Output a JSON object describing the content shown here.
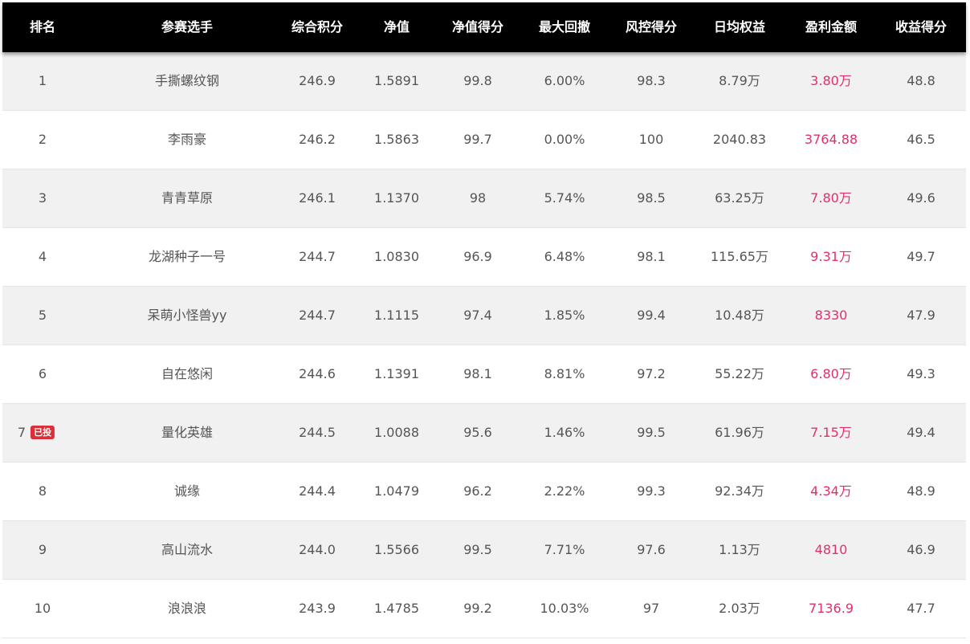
{
  "colors": {
    "header_bg": "#000000",
    "header_text": "#ffffff",
    "row_odd_bg": "#f1f1f1",
    "row_even_bg": "#ffffff",
    "text": "#555555",
    "profit_text": "#e0306a",
    "badge_bg": "#d9303a"
  },
  "table": {
    "headers": [
      "排名",
      "参赛选手",
      "综合积分",
      "净值",
      "净值得分",
      "最大回撤",
      "风控得分",
      "日均权益",
      "盈利金额",
      "收益得分"
    ],
    "rows": [
      {
        "rank": "1",
        "badge": "",
        "player": "手撕螺纹钢",
        "score": "246.9",
        "nav": "1.5891",
        "nav_score": "99.8",
        "max_drawdown": "6.00%",
        "risk_score": "98.3",
        "avg_equity": "8.79万",
        "profit": "3.80万",
        "return_score": "48.8"
      },
      {
        "rank": "2",
        "badge": "",
        "player": "李雨豪",
        "score": "246.2",
        "nav": "1.5863",
        "nav_score": "99.7",
        "max_drawdown": "0.00%",
        "risk_score": "100",
        "avg_equity": "2040.83",
        "profit": "3764.88",
        "return_score": "46.5"
      },
      {
        "rank": "3",
        "badge": "",
        "player": "青青草原",
        "score": "246.1",
        "nav": "1.1370",
        "nav_score": "98",
        "max_drawdown": "5.74%",
        "risk_score": "98.5",
        "avg_equity": "63.25万",
        "profit": "7.80万",
        "return_score": "49.6"
      },
      {
        "rank": "4",
        "badge": "",
        "player": "龙湖种子一号",
        "score": "244.7",
        "nav": "1.0830",
        "nav_score": "96.9",
        "max_drawdown": "6.48%",
        "risk_score": "98.1",
        "avg_equity": "115.65万",
        "profit": "9.31万",
        "return_score": "49.7"
      },
      {
        "rank": "5",
        "badge": "",
        "player": "呆萌小怪兽yy",
        "score": "244.7",
        "nav": "1.1115",
        "nav_score": "97.4",
        "max_drawdown": "1.85%",
        "risk_score": "99.4",
        "avg_equity": "10.48万",
        "profit": "8330",
        "return_score": "47.9"
      },
      {
        "rank": "6",
        "badge": "",
        "player": "自在悠闲",
        "score": "244.6",
        "nav": "1.1391",
        "nav_score": "98.1",
        "max_drawdown": "8.81%",
        "risk_score": "97.2",
        "avg_equity": "55.22万",
        "profit": "6.80万",
        "return_score": "49.3"
      },
      {
        "rank": "7",
        "badge": "已投",
        "player": "量化英雄",
        "score": "244.5",
        "nav": "1.0088",
        "nav_score": "95.6",
        "max_drawdown": "1.46%",
        "risk_score": "99.5",
        "avg_equity": "61.96万",
        "profit": "7.15万",
        "return_score": "49.4"
      },
      {
        "rank": "8",
        "badge": "",
        "player": "诚缘",
        "score": "244.4",
        "nav": "1.0479",
        "nav_score": "96.2",
        "max_drawdown": "2.22%",
        "risk_score": "99.3",
        "avg_equity": "92.34万",
        "profit": "4.34万",
        "return_score": "48.9"
      },
      {
        "rank": "9",
        "badge": "",
        "player": "高山流水",
        "score": "244.0",
        "nav": "1.5566",
        "nav_score": "99.5",
        "max_drawdown": "7.71%",
        "risk_score": "97.6",
        "avg_equity": "1.13万",
        "profit": "4810",
        "return_score": "46.9"
      },
      {
        "rank": "10",
        "badge": "",
        "player": "浪浪浪",
        "score": "243.9",
        "nav": "1.4785",
        "nav_score": "99.2",
        "max_drawdown": "10.03%",
        "risk_score": "97",
        "avg_equity": "2.03万",
        "profit": "7136.9",
        "return_score": "47.7"
      }
    ]
  }
}
